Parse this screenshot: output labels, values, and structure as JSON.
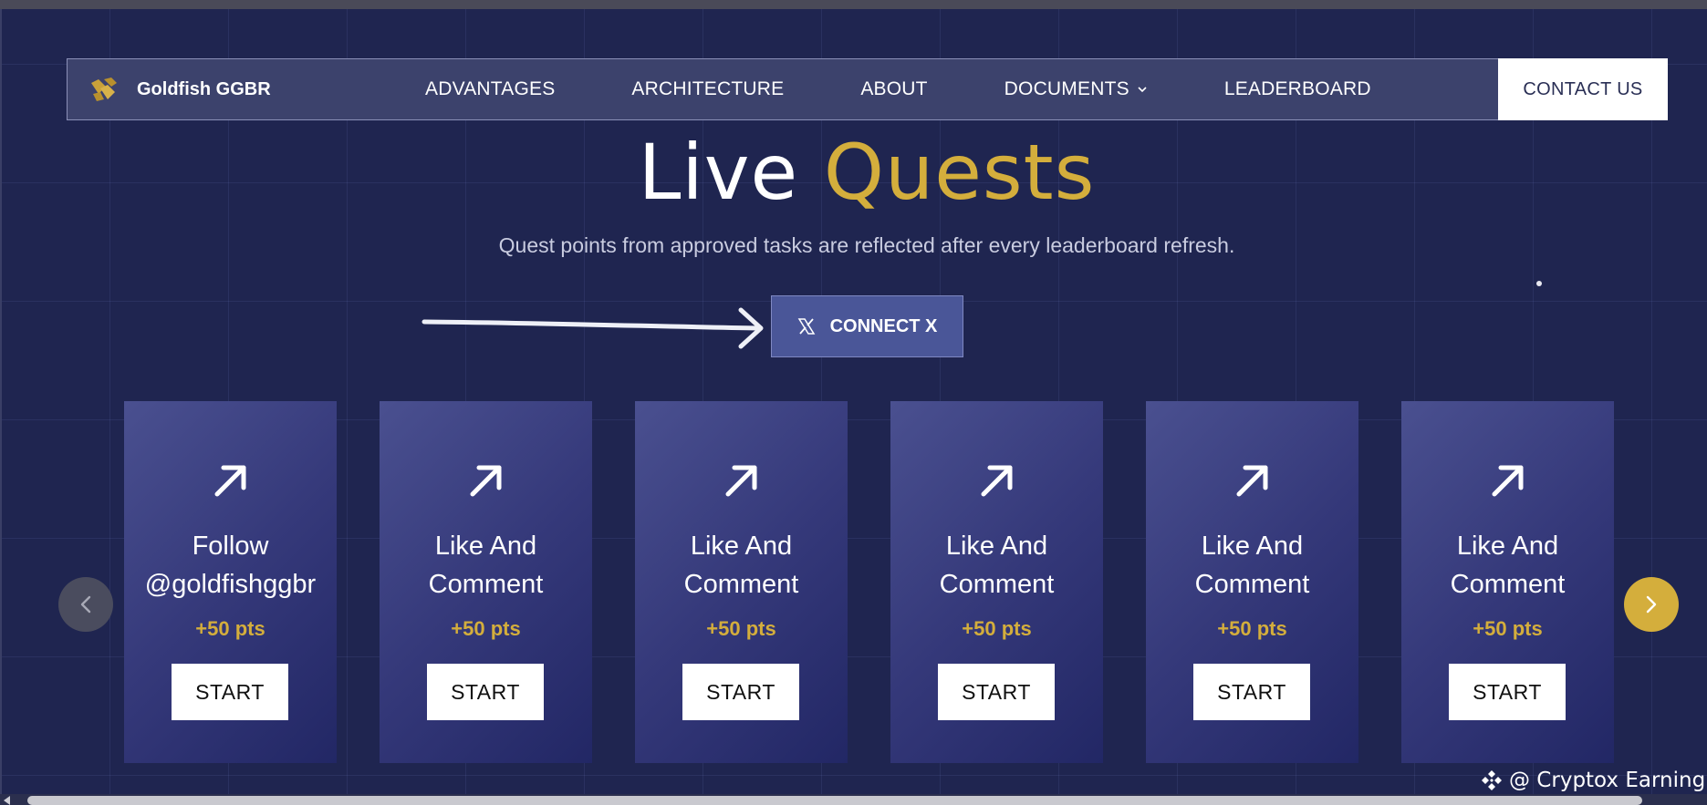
{
  "navbar": {
    "brand_name": "Goldfish GGBR",
    "items": [
      {
        "label": "ADVANTAGES"
      },
      {
        "label": "ARCHITECTURE"
      },
      {
        "label": "ABOUT"
      },
      {
        "label": "DOCUMENTS",
        "has_dropdown": true
      },
      {
        "label": "LEADERBOARD"
      }
    ],
    "contact_label": "CONTACT US"
  },
  "hero": {
    "title_part1": "Live",
    "title_part2": "Quests",
    "subtitle": "Quest points from approved tasks are reflected after every leaderboard refresh."
  },
  "connect": {
    "label": "CONNECT X",
    "icon": "x-logo-icon"
  },
  "quests": [
    {
      "title_line1": "Follow",
      "title_line2": "@goldfishggbr",
      "points": "+50 pts",
      "action": "START"
    },
    {
      "title_line1": "Like And",
      "title_line2": "Comment",
      "points": "+50 pts",
      "action": "START"
    },
    {
      "title_line1": "Like And",
      "title_line2": "Comment",
      "points": "+50 pts",
      "action": "START"
    },
    {
      "title_line1": "Like And",
      "title_line2": "Comment",
      "points": "+50 pts",
      "action": "START"
    },
    {
      "title_line1": "Like And",
      "title_line2": "Comment",
      "points": "+50 pts",
      "action": "START"
    },
    {
      "title_line1": "Like And",
      "title_line2": "Comment",
      "points": "+50 pts",
      "action": "START"
    }
  ],
  "watermark": {
    "text": "@ Cryptox Earning"
  },
  "colors": {
    "background": "#1f2550",
    "accent_gold": "#d4ae3c",
    "navbar_bg": "#3c426c",
    "connect_bg": "#4a5698"
  }
}
